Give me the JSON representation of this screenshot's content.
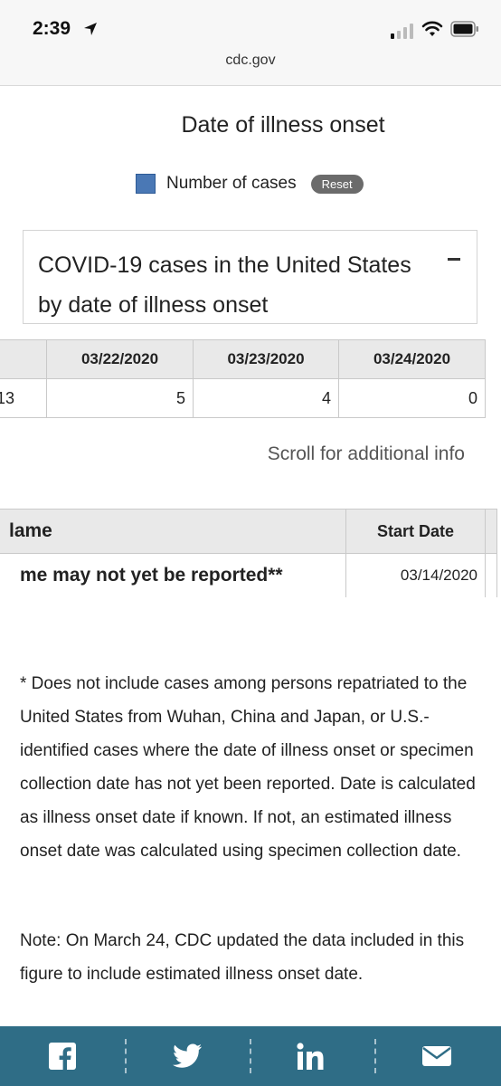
{
  "status_bar": {
    "time": "2:39"
  },
  "browser": {
    "url": "cdc.gov"
  },
  "chart": {
    "title": "Date of illness onset",
    "legend": {
      "label": "Number of cases",
      "color": "#4a78b5"
    },
    "reset_label": "Reset"
  },
  "panel": {
    "title": "COVID-19 cases in the United States by date of illness onset"
  },
  "cases_table": {
    "partial_first_cell": "13",
    "headers": [
      "03/22/2020",
      "03/23/2020",
      "03/24/2020"
    ],
    "values": [
      "5",
      "4",
      "0"
    ]
  },
  "scroll_hint": "Scroll for additional info",
  "period_table": {
    "headers": {
      "name": "lame",
      "start_date": "Start Date"
    },
    "row": {
      "name": "me may not yet be reported**",
      "start_date": "03/14/2020"
    }
  },
  "footnote": "* Does not include cases among persons repatriated to the United States from Wuhan, China and Japan, or U.S.-identified cases where the date of illness onset or specimen collection date has not yet been reported. Date is calculated as illness onset date if known. If not, an estimated illness onset date was calculated using specimen collection date.",
  "update_note": "Note: On March 24, CDC updated the data included in this figure to include estimated illness onset date.",
  "share_bar": {
    "items": [
      "facebook-icon",
      "twitter-icon",
      "linkedin-icon",
      "email-icon"
    ],
    "background": "#2f6d86"
  }
}
